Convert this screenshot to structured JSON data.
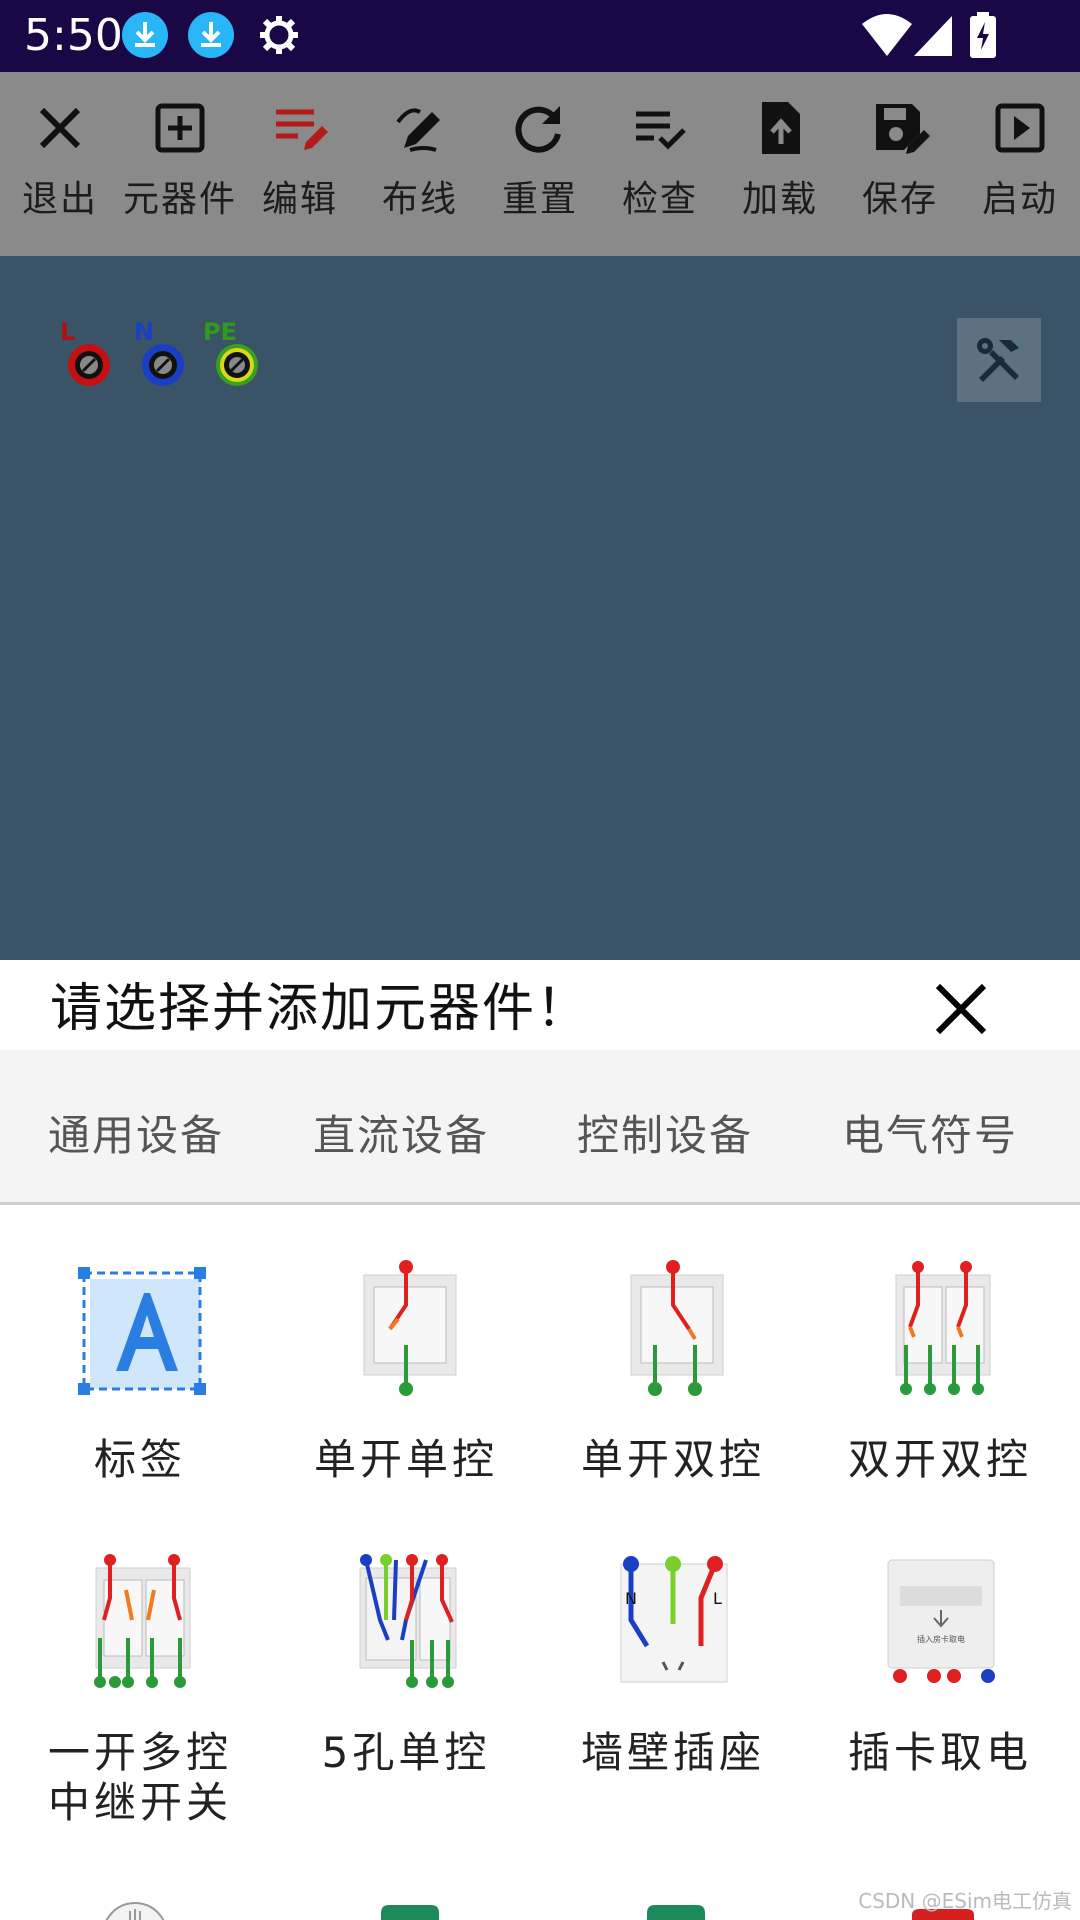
{
  "status_bar": {
    "time": "5:50",
    "icons": [
      "download-icon",
      "download-icon",
      "gear-icon",
      "wifi-icon",
      "signal-icon",
      "battery-charging-icon"
    ]
  },
  "toolbar": {
    "items": [
      {
        "label": "退出",
        "icon": "close-icon"
      },
      {
        "label": "元器件",
        "icon": "add-box-icon"
      },
      {
        "label": "编辑",
        "icon": "edit-list-icon",
        "color": "#b41a1a"
      },
      {
        "label": "布线",
        "icon": "draw-icon"
      },
      {
        "label": "重置",
        "icon": "refresh-icon"
      },
      {
        "label": "检查",
        "icon": "checklist-icon"
      },
      {
        "label": "加载",
        "icon": "upload-file-icon"
      },
      {
        "label": "保存",
        "icon": "save-edit-icon"
      },
      {
        "label": "启动",
        "icon": "play-box-icon"
      }
    ]
  },
  "canvas": {
    "terminals": [
      {
        "label": "L",
        "color": "#c41010"
      },
      {
        "label": "N",
        "color": "#1a3fc4"
      },
      {
        "label": "PE",
        "color": "#3aa020"
      }
    ],
    "tools_icon": "tools-icon"
  },
  "sheet": {
    "title": "请选择并添加元器件！",
    "close_icon": "close-icon"
  },
  "tabs": [
    "通用设备",
    "直流设备",
    "控制设备",
    "电气符号"
  ],
  "components": [
    {
      "label": "标签",
      "icon": "label-a-icon"
    },
    {
      "label": "单开单控",
      "icon": "single-switch-icon"
    },
    {
      "label": "单开双控",
      "icon": "single-two-way-switch-icon"
    },
    {
      "label": "双开双控",
      "icon": "double-two-way-switch-icon"
    },
    {
      "label": "一开多控\n中继开关",
      "icon": "relay-switch-icon"
    },
    {
      "label": "5孔单控",
      "icon": "socket-switch-icon"
    },
    {
      "label": "墙壁插座",
      "icon": "wall-socket-icon"
    },
    {
      "label": "插卡取电",
      "icon": "card-power-switch-icon"
    }
  ],
  "card_caption": "插入房卡取电",
  "watermark": "CSDN @ESim电工仿真",
  "colors": {
    "status_bar": "#1a0746",
    "toolbar": "#8a8a8a",
    "canvas": "#3a5366",
    "accent_edit": "#b41a1a"
  }
}
